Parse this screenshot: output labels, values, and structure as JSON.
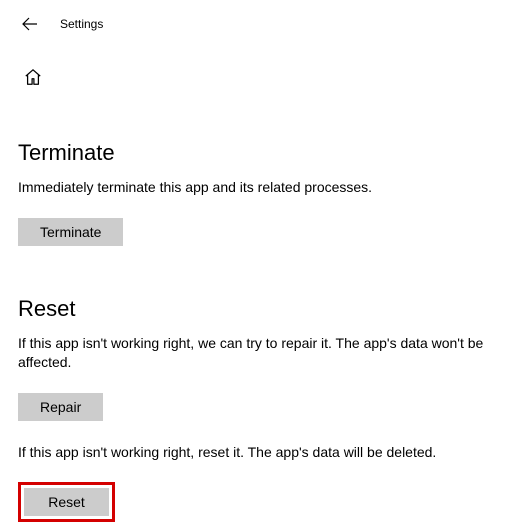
{
  "header": {
    "title": "Settings"
  },
  "sections": {
    "terminate": {
      "heading": "Terminate",
      "description": "Immediately terminate this app and its related processes.",
      "button_label": "Terminate"
    },
    "reset": {
      "heading": "Reset",
      "repair_description": "If this app isn't working right, we can try to repair it. The app's data won't be affected.",
      "repair_button_label": "Repair",
      "reset_description": "If this app isn't working right, reset it. The app's data will be deleted.",
      "reset_button_label": "Reset"
    }
  }
}
